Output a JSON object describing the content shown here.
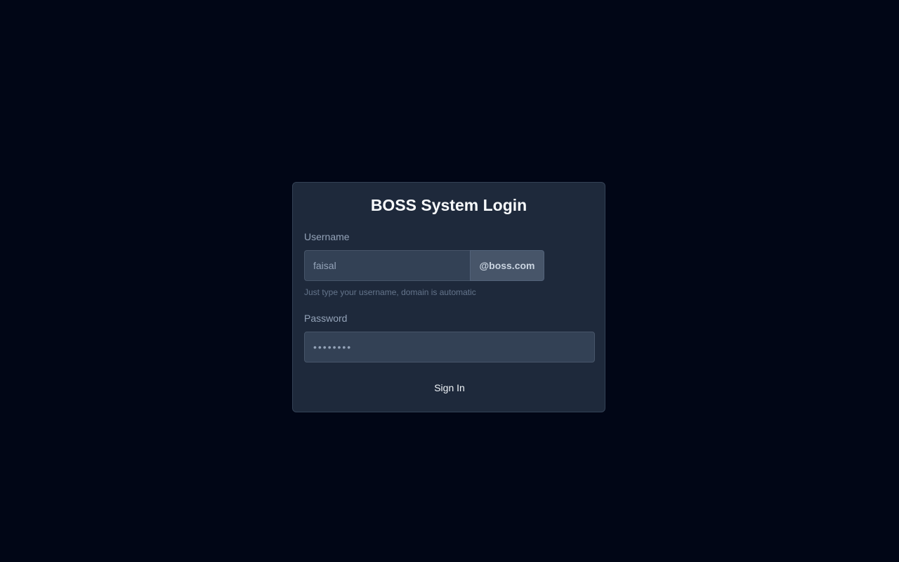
{
  "login": {
    "title": "BOSS System Login",
    "username_label": "Username",
    "username_placeholder": "faisal",
    "domain_suffix": "@boss.com",
    "username_hint": "Just type your username, domain is automatic",
    "password_label": "Password",
    "password_placeholder": "••••••••",
    "signin_label": "Sign In"
  },
  "colors": {
    "background": "#010616",
    "card": "#1e293b",
    "input": "#334155",
    "suffix": "#475569"
  }
}
